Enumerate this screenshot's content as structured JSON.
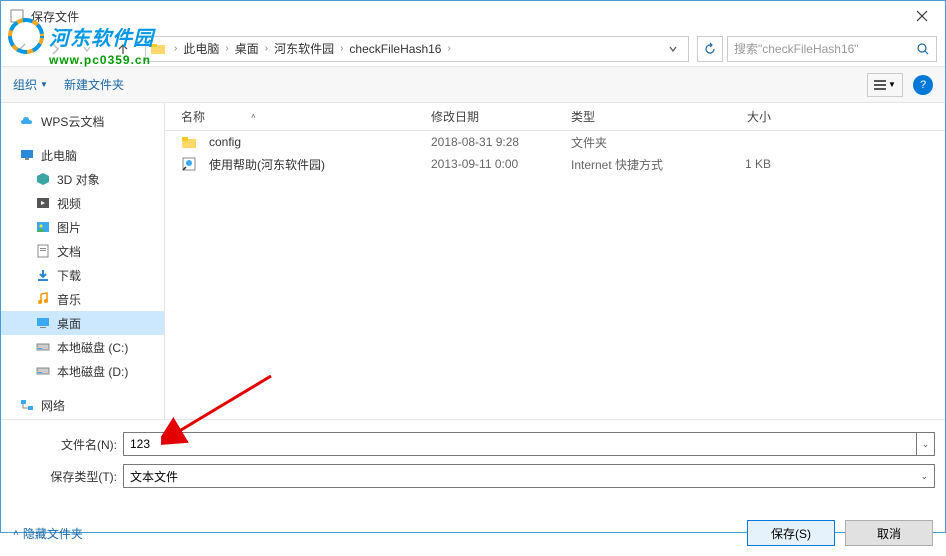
{
  "window": {
    "title": "保存文件"
  },
  "breadcrumb": {
    "items": [
      "此电脑",
      "桌面",
      "河东软件园",
      "checkFileHash16"
    ]
  },
  "search": {
    "placeholder": "搜索\"checkFileHash16\""
  },
  "toolbar": {
    "organize": "组织",
    "newfolder": "新建文件夹"
  },
  "sidebar": {
    "wps": "WPS云文档",
    "pc": "此电脑",
    "items": {
      "obj3d": "3D 对象",
      "video": "视频",
      "pic": "图片",
      "doc": "文档",
      "dl": "下载",
      "music": "音乐",
      "desktop": "桌面",
      "diskc": "本地磁盘 (C:)",
      "diskd": "本地磁盘 (D:)"
    },
    "network": "网络"
  },
  "columns": {
    "name": "名称",
    "date": "修改日期",
    "type": "类型",
    "size": "大小"
  },
  "rows": [
    {
      "name": "config",
      "date": "2018-08-31 9:28",
      "type": "文件夹",
      "size": ""
    },
    {
      "name": "使用帮助(河东软件园)",
      "date": "2013-09-11 0:00",
      "type": "Internet 快捷方式",
      "size": "1 KB"
    }
  ],
  "fields": {
    "filename_label": "文件名(N):",
    "filename_value": "123",
    "filetype_label": "保存类型(T):",
    "filetype_value": "文本文件"
  },
  "footer": {
    "hide": "隐藏文件夹",
    "save": "保存(S)",
    "cancel": "取消"
  },
  "watermark": {
    "brand": "河东软件园",
    "url": "www.pc0359.cn"
  }
}
